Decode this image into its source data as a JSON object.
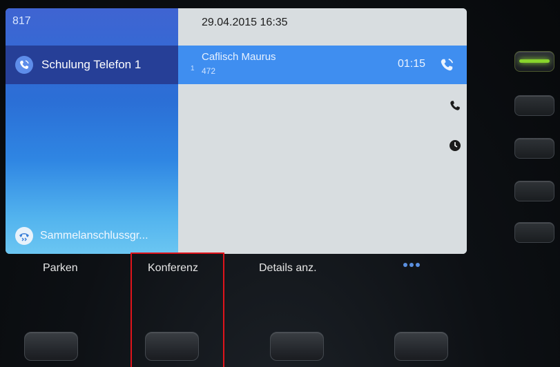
{
  "screen": {
    "line_number": "817",
    "datetime": "29.04.2015 16:35",
    "lines": [
      {
        "label": "Schulung Telefon 1",
        "icon": "call-active-icon"
      },
      {
        "label": "Sammelanschlussgr...",
        "icon": "hunt-group-icon"
      }
    ],
    "call": {
      "index": "1",
      "name": "Caflisch Maurus",
      "number": "472",
      "timer": "01:15",
      "icon": "call-active-icon"
    },
    "side_icons": [
      "phone-handset-icon",
      "clock-icon"
    ]
  },
  "softkeys": {
    "labels": [
      "Parken",
      "Konferenz",
      "Details anz."
    ],
    "more_icon": "more-dots-icon"
  },
  "line_keys": {
    "count": 5,
    "active_index": 0
  },
  "colors": {
    "header_blue": "#263f97",
    "call_blue": "#3f8ef0",
    "led_green": "#88d42c",
    "highlight_red": "#e0141b"
  }
}
